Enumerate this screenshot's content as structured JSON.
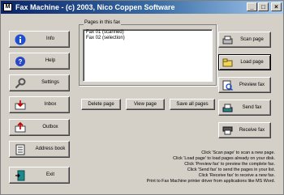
{
  "window": {
    "title": "Fax Machine - (c) 2003, Nico Coppen Software"
  },
  "sidebar": {
    "items": [
      {
        "label": "Info",
        "icon": "info-icon"
      },
      {
        "label": "Help",
        "icon": "help-icon"
      },
      {
        "label": "Settings",
        "icon": "settings-icon"
      },
      {
        "label": "Inbox",
        "icon": "inbox-icon"
      },
      {
        "label": "Outbox",
        "icon": "outbox-icon"
      },
      {
        "label": "Address book",
        "icon": "address-book-icon"
      },
      {
        "label": "Exit",
        "icon": "exit-icon"
      }
    ]
  },
  "pages": {
    "group_label": "Pages in this fax",
    "list": [
      "Fax 01 (scanned)",
      "Fax 02 (selection)"
    ],
    "delete_label": "Delete page",
    "view_label": "View page",
    "save_all_label": "Save all pages"
  },
  "actions": {
    "scan_label": "Scan page",
    "load_label": "Load page",
    "preview_label": "Preview fax",
    "send_label": "Send fax",
    "receive_label": "Receive fax"
  },
  "help": {
    "lines": [
      "Click 'Scan page' to scan a new page.",
      "Click 'Load page' to load pages already on your disk.",
      "Click 'Preview fax' to preview the complete fax.",
      "Click 'Send fax' to send the pages in your list.",
      "Click 'Receive fax' to receive a new fax.",
      "Print to Fax Machine printer driver from applications like MS Word."
    ]
  },
  "colors": {
    "titlebar_start": "#0a246a",
    "titlebar_end": "#a6caf0",
    "face": "#d4d0c8"
  }
}
